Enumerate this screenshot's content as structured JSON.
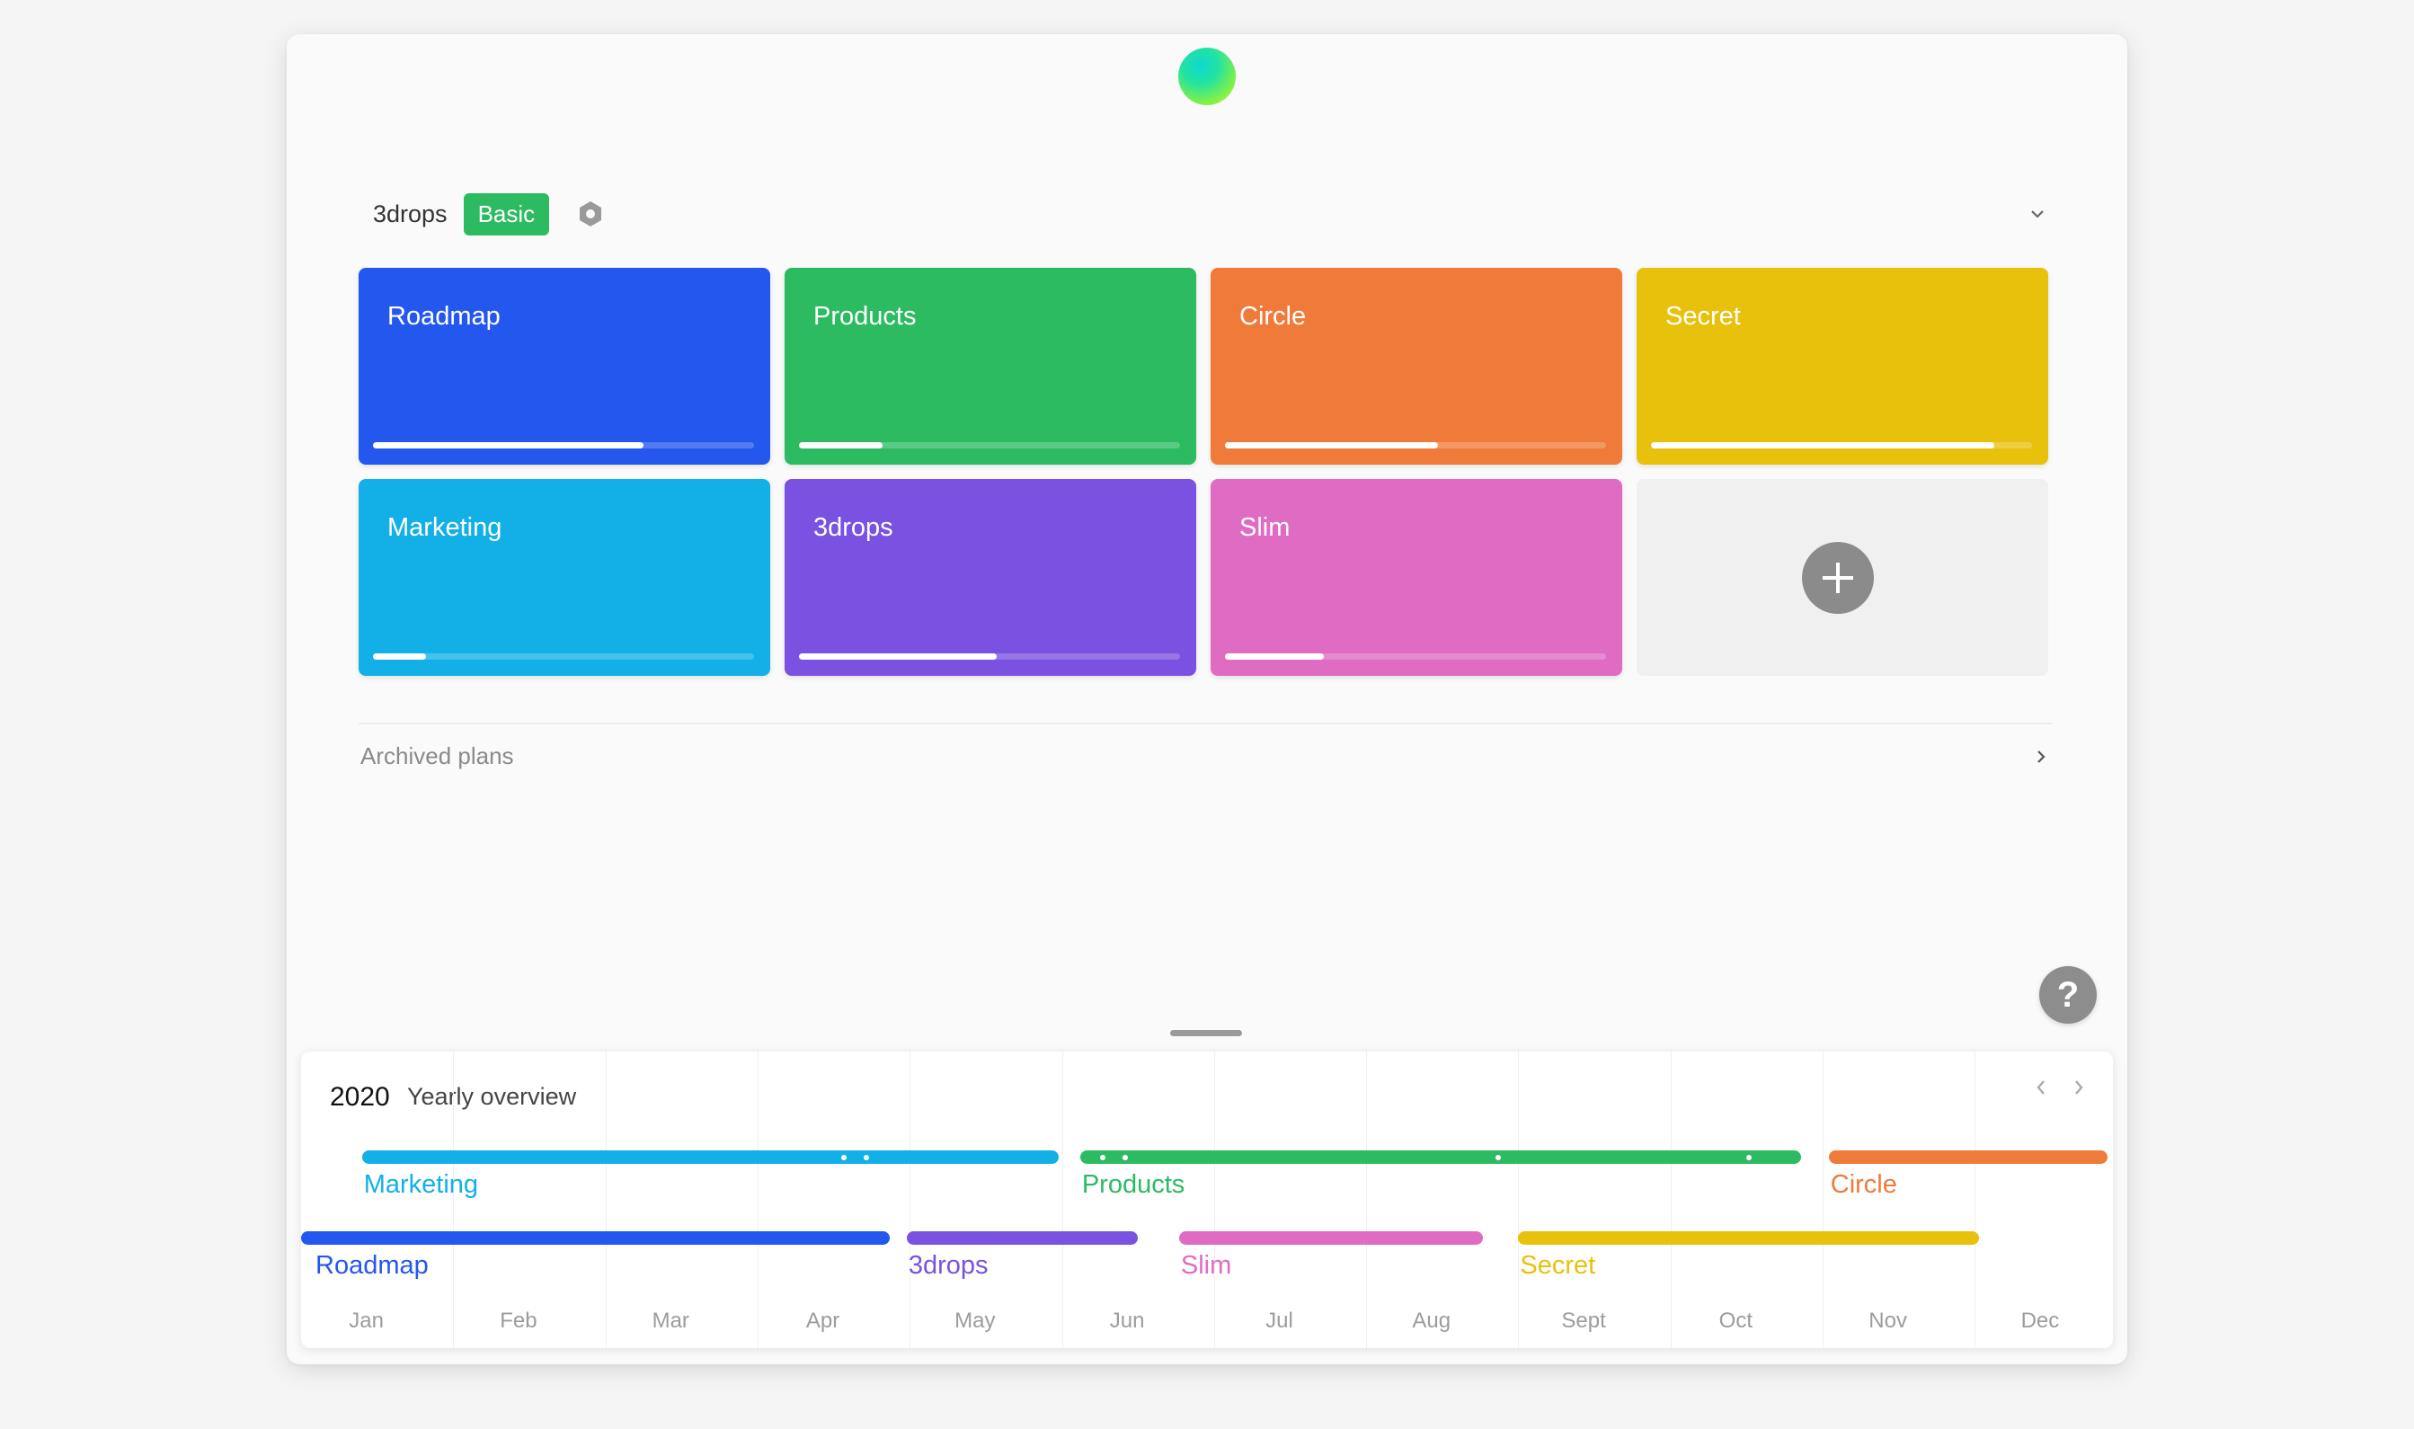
{
  "workspace": {
    "name": "3drops",
    "plan_badge": "Basic",
    "settings_icon": "settings-hex-icon",
    "collapse_icon": "chevron-down-icon"
  },
  "plans": [
    {
      "name": "Roadmap",
      "color": "#2457ee",
      "progress": 0.71
    },
    {
      "name": "Products",
      "color": "#2dbb62",
      "progress": 0.22
    },
    {
      "name": "Circle",
      "color": "#f07a3a",
      "progress": 0.56
    },
    {
      "name": "Secret",
      "color": "#e8c10d",
      "progress": 0.9
    },
    {
      "name": "Marketing",
      "color": "#12b0e6",
      "progress": 0.14
    },
    {
      "name": "3drops",
      "color": "#7a51e0",
      "progress": 0.52
    },
    {
      "name": "Slim",
      "color": "#e06bc3",
      "progress": 0.26
    }
  ],
  "add_plan_icon": "plus-icon",
  "archived": {
    "label": "Archived plans",
    "icon": "chevron-right-icon"
  },
  "help": {
    "label": "?"
  },
  "timeline": {
    "year": "2020",
    "title": "Yearly overview",
    "prev_icon": "chevron-left-icon",
    "next_icon": "chevron-right-icon",
    "months": [
      "Jan",
      "Feb",
      "Mar",
      "Apr",
      "May",
      "Jun",
      "Jul",
      "Aug",
      "Sept",
      "Oct",
      "Nov",
      "Dec"
    ],
    "bars": [
      {
        "name": "Marketing",
        "color": "#12b0e6",
        "start": 0.4,
        "end": 4.98,
        "row": 0,
        "dots": [
          3.55,
          3.7
        ]
      },
      {
        "name": "Products",
        "color": "#2dbb62",
        "start": 5.12,
        "end": 9.86,
        "row": 0,
        "dots": [
          5.25,
          5.4,
          7.85,
          9.5
        ]
      },
      {
        "name": "Circle",
        "color": "#f07a3a",
        "start": 10.04,
        "end": 11.87,
        "row": 0,
        "dots": []
      },
      {
        "name": "Roadmap",
        "color": "#2457ee",
        "start": 0.0,
        "end": 3.87,
        "row": 1,
        "dots": []
      },
      {
        "name": "3drops",
        "color": "#7a51e0",
        "start": 3.98,
        "end": 5.5,
        "row": 1,
        "dots": []
      },
      {
        "name": "Slim",
        "color": "#e06bc3",
        "start": 5.77,
        "end": 7.77,
        "row": 1,
        "dots": []
      },
      {
        "name": "Secret",
        "color": "#e8c10d",
        "start": 8.0,
        "end": 11.03,
        "row": 1,
        "dots": []
      }
    ]
  }
}
